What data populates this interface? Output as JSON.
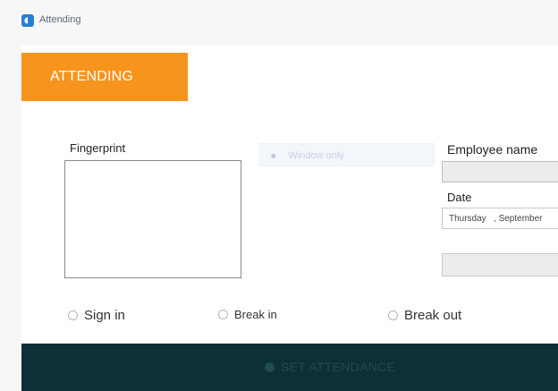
{
  "window": {
    "title": "Attending",
    "icon": "app-icon"
  },
  "header": {
    "tab_label": "ATTENDING",
    "accent_color": "#f7941d"
  },
  "fingerprint": {
    "label": "Fingerprint"
  },
  "window_only_strip": {
    "icon": "window-icon",
    "text": "Window only"
  },
  "employee": {
    "name_label": "Employee name",
    "name_value": ""
  },
  "date": {
    "label": "Date",
    "value": "Thursday   , September"
  },
  "attendance_type": {
    "options": [
      {
        "label": "Sign in",
        "selected": false
      },
      {
        "label": "Break in",
        "selected": false
      },
      {
        "label": "Break out",
        "selected": false
      }
    ]
  },
  "footer": {
    "button_label": "SET ATTENDANCE",
    "background_color": "#0d2f36"
  }
}
